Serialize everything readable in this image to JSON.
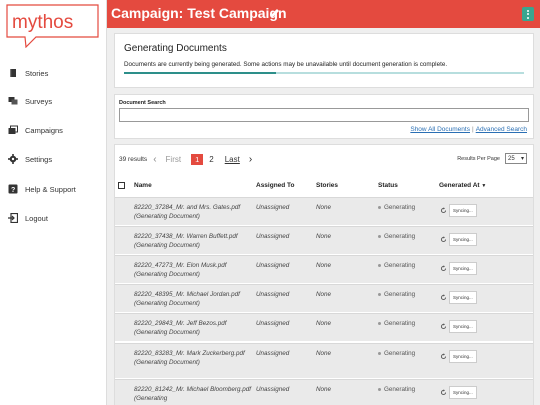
{
  "app": {
    "logo_text": "mythos"
  },
  "sidebar": {
    "items": [
      {
        "label": "Stories",
        "icon": "book-icon"
      },
      {
        "label": "Surveys",
        "icon": "chat-bubbles-icon"
      },
      {
        "label": "Campaigns",
        "icon": "campaigns-icon"
      },
      {
        "label": "Settings",
        "icon": "gear-icon"
      },
      {
        "label": "Help & Support",
        "icon": "help-icon"
      },
      {
        "label": "Logout",
        "icon": "logout-icon"
      }
    ]
  },
  "header": {
    "title": "Campaign: Test Campaign",
    "edit_icon": "pencil-icon",
    "menu_icon": "kebab-menu-icon"
  },
  "colors": {
    "brand_red": "#e44a3f",
    "progress_fill": "#2d8f8a",
    "menu_green": "#3aa58f"
  },
  "generating": {
    "title": "Generating Documents",
    "message": "Documents are currently being generated. Some actions may be unavailable until document generation is complete.",
    "progress": 0.38
  },
  "search": {
    "label": "Document Search",
    "value": "",
    "show_all_label": "Show All Documents",
    "separator": "|",
    "advanced_label": "Advanced Search"
  },
  "pager": {
    "count": "39 results",
    "first_label": "First",
    "current_page": "1",
    "next_page": "2",
    "last_label": "Last",
    "rpp_label": "Results Per Page",
    "rpp_value": "25"
  },
  "table": {
    "columns": {
      "name": "Name",
      "assigned": "Assigned To",
      "stories": "Stories",
      "status": "Status",
      "generated": "Generated At"
    },
    "rows": [
      {
        "name": "82220_37284_Mr. and Mrs. Gates.pdf (Generating Document)",
        "assigned": "Unassigned",
        "stories": "None",
        "status": "Generating",
        "sync": "Syncing..."
      },
      {
        "name": "82220_37438_Mr. Warren Buffett.pdf (Generating Document)",
        "assigned": "Unassigned",
        "stories": "None",
        "status": "Generating",
        "sync": "Syncing..."
      },
      {
        "name": "82220_47273_Mr. Elon Musk.pdf (Generating Document)",
        "assigned": "Unassigned",
        "stories": "None",
        "status": "Generating",
        "sync": "Syncing..."
      },
      {
        "name": "82220_48395_Mr. Michael Jordan.pdf (Generating Document)",
        "assigned": "Unassigned",
        "stories": "None",
        "status": "Generating",
        "sync": "Syncing..."
      },
      {
        "name": "82220_29843_Mr. Jeff Bezos.pdf (Generating Document)",
        "assigned": "Unassigned",
        "stories": "None",
        "status": "Generating",
        "sync": "Syncing..."
      },
      {
        "name": "82220_83283_Mr. Mark Zuckerberg.pdf (Generating Document)",
        "assigned": "Unassigned",
        "stories": "None",
        "status": "Generating",
        "sync": "Syncing..."
      },
      {
        "name": "82220_81242_Mr. Michael Bloomberg.pdf (Generating",
        "assigned": "Unassigned",
        "stories": "None",
        "status": "Generating",
        "sync": "Syncing..."
      }
    ]
  }
}
